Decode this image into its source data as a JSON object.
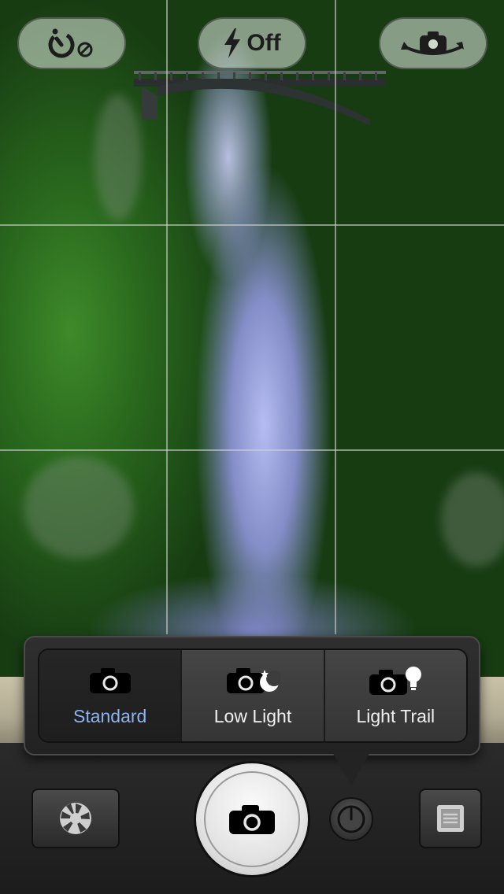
{
  "top_bar": {
    "timer_icon": "self-timer-off-icon",
    "flash": {
      "icon": "flash-icon",
      "label": "Off"
    },
    "switch_camera_icon": "switch-camera-icon"
  },
  "mode_picker": {
    "options": [
      {
        "label": "Standard",
        "icon": "camera-icon",
        "selected": true
      },
      {
        "label": "Low Light",
        "icon": "camera-moon-icon",
        "selected": false
      },
      {
        "label": "Light Trail",
        "icon": "camera-bulb-icon",
        "selected": false
      }
    ]
  },
  "controls": {
    "filters_icon": "aperture-icon",
    "shutter_icon": "camera-icon",
    "mode_dial_icon": "mode-dial-icon",
    "gallery_icon": "gallery-icon"
  },
  "colors": {
    "selected_mode": "#8db2f0",
    "mode_text": "#f0f0f0",
    "toolbar_bg": "#2b2b2b"
  }
}
